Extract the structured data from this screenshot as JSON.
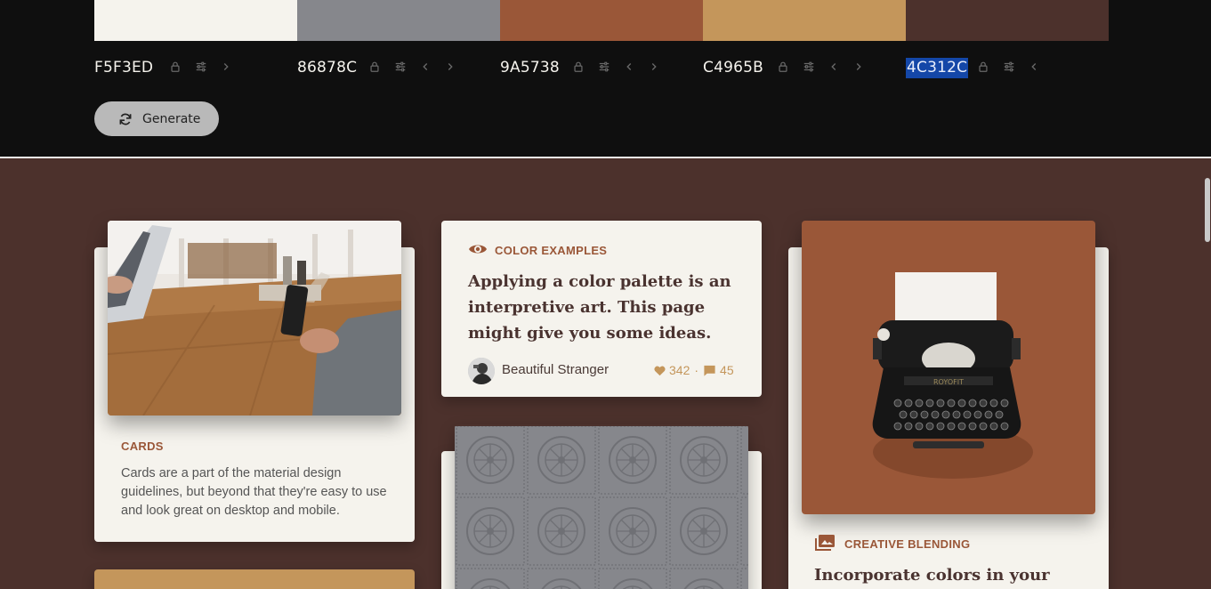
{
  "palette": {
    "colors": [
      {
        "hex": "F5F3ED",
        "color": "#F5F3ED"
      },
      {
        "hex": "86878C",
        "color": "#86878C"
      },
      {
        "hex": "9A5738",
        "color": "#9A5738"
      },
      {
        "hex": "C4965B",
        "color": "#C4965B"
      },
      {
        "hex": "4C312C",
        "color": "#4C312C"
      }
    ],
    "selected_hex": "4C312C",
    "icons": [
      "lock-icon",
      "sliders-icon",
      "chevron-left-icon",
      "chevron-right-icon"
    ],
    "generate_label": "Generate",
    "generate_icon": "refresh-icon"
  },
  "cards": {
    "left": {
      "tag": "CARDS",
      "body": "Cards are a part of the material design guidelines, but beyond that they're easy to use and look great on desktop and mobile."
    },
    "middle": {
      "tag_icon": "eye-icon",
      "tag": "COLOR EXAMPLES",
      "title": "Applying a color palette is an interpretive art. This page might give you some ideas.",
      "author": "Beautiful Stranger",
      "likes": "342",
      "separator": "·",
      "comments": "45"
    },
    "right": {
      "tag_icon": "images-icon",
      "tag": "CREATIVE BLENDING",
      "title": "Incorporate colors in your"
    }
  }
}
